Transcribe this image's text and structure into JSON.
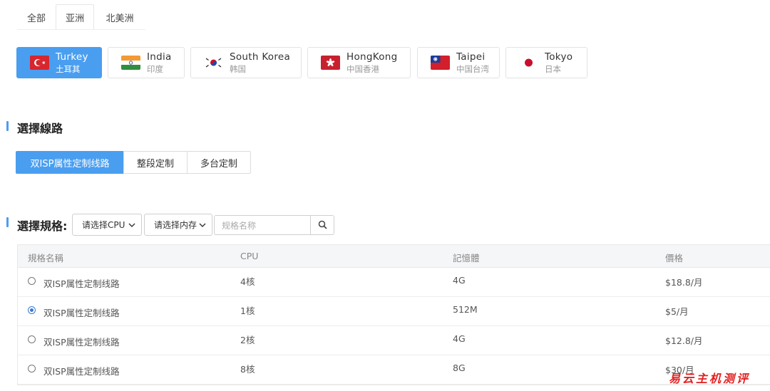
{
  "continent_tabs": [
    {
      "label": "全部",
      "active": false
    },
    {
      "label": "亚洲",
      "active": true
    },
    {
      "label": "北美洲",
      "active": false
    }
  ],
  "regions": [
    {
      "name": "Turkey",
      "sub": "土耳其",
      "active": true,
      "flag_icon": "turkey-flag-icon"
    },
    {
      "name": "India",
      "sub": "印度",
      "active": false,
      "flag_icon": "india-flag-icon"
    },
    {
      "name": "South Korea",
      "sub": "韩国",
      "active": false,
      "flag_icon": "south-korea-flag-icon"
    },
    {
      "name": "HongKong",
      "sub": "中国香港",
      "active": false,
      "flag_icon": "hongkong-flag-icon"
    },
    {
      "name": "Taipei",
      "sub": "中国台湾",
      "active": false,
      "flag_icon": "taipei-flag-icon"
    },
    {
      "name": "Tokyo",
      "sub": "日本",
      "active": false,
      "flag_icon": "tokyo-flag-icon"
    }
  ],
  "line_section": {
    "title": "選擇線路",
    "options": [
      {
        "label": "双ISP属性定制线路",
        "active": true
      },
      {
        "label": "整段定制",
        "active": false
      },
      {
        "label": "多台定制",
        "active": false
      }
    ]
  },
  "spec_section": {
    "title": "選擇規格:",
    "cpu_select": "请选择CPU",
    "memory_select": "请选择内存",
    "search_placeholder": "规格名称",
    "search_icon": "search-icon"
  },
  "table": {
    "headers": [
      "規格名稱",
      "CPU",
      "記憶體",
      "價格"
    ],
    "rows": [
      {
        "name": "双ISP属性定制线路",
        "cpu": "4核",
        "memory": "4G",
        "price": "$18.8/月",
        "selected": false
      },
      {
        "name": "双ISP属性定制线路",
        "cpu": "1核",
        "memory": "512M",
        "price": "$5/月",
        "selected": true
      },
      {
        "name": "双ISP属性定制线路",
        "cpu": "2核",
        "memory": "4G",
        "price": "$12.8/月",
        "selected": false
      },
      {
        "name": "双ISP属性定制线路",
        "cpu": "8核",
        "memory": "8G",
        "price": "$30/月",
        "selected": false
      }
    ]
  },
  "watermark": "易云主机测评",
  "colors": {
    "accent": "#4a9ef0",
    "watermark": "#e32020"
  }
}
